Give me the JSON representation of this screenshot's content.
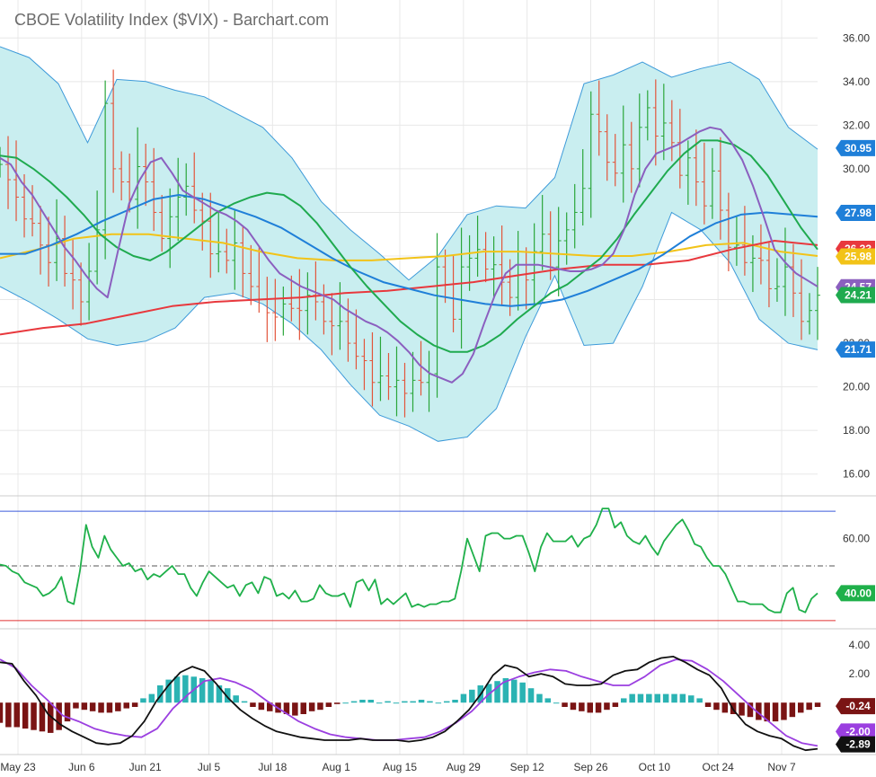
{
  "header": {
    "title": "CBOE Volatility Index ($VIX) - Barchart.com"
  },
  "colors": {
    "band_fill": "#c9eef0",
    "band_edge": "#3d9ad9",
    "up_bar": "#2aa63a",
    "down_bar": "#e2553b",
    "sma_purple": "#8b5fbf",
    "sma_green": "#1faa4f",
    "sma_blue": "#1f7fd8",
    "sma_yellow": "#f2c318",
    "sma_red": "#e8383d",
    "rsi_line": "#1fb04a",
    "macd_line": "#111111",
    "signal_line": "#9b3fe0",
    "hist_pos": "#2bb3b3",
    "hist_neg": "#7a1414",
    "grid": "#e8e8e8"
  },
  "chart_data": [
    {
      "type": "line",
      "panel": "price",
      "title": "CBOE Volatility Index ($VIX) - Barchart.com",
      "x": [
        "May 23",
        "Jun 6",
        "Jun 21",
        "Jul 5",
        "Jul 18",
        "Aug 1",
        "Aug 15",
        "Aug 29",
        "Sep 12",
        "Sep 26",
        "Oct 10",
        "Oct 24",
        "Nov 7"
      ],
      "ylim": [
        15,
        37
      ],
      "yticks": [
        "36.00",
        "34.00",
        "32.00",
        "30.00",
        "28.00",
        "26.00",
        "24.00",
        "22.00",
        "20.00",
        "18.00",
        "16.00"
      ],
      "close": [
        30.2,
        29.5,
        28.7,
        27.7,
        27.5,
        26.5,
        25.7,
        26.8,
        25.2,
        24.9,
        23.9,
        25.3,
        27.2,
        33.0,
        30.0,
        29.4,
        28.6,
        30.1,
        29.4,
        28.0,
        26.8,
        27.8,
        28.7,
        29.2,
        28.1,
        27.6,
        26.1,
        26.2,
        25.8,
        26.6,
        25.2,
        24.6,
        24.0,
        23.4,
        23.2,
        23.8,
        23.6,
        23.5,
        24.2,
        23.9,
        23.0,
        22.8,
        23.0,
        22.0,
        21.4,
        21.2,
        20.2,
        20.5,
        20.0,
        20.3,
        19.7,
        20.3,
        20.2,
        20.6,
        25.5,
        24.7,
        23.1,
        25.5,
        25.9,
        26.3,
        25.4,
        25.6,
        24.8,
        24.1,
        25.6,
        24.9,
        26.2,
        27.0,
        25.5,
        26.7,
        27.2,
        28.0,
        29.1,
        32.5,
        31.7,
        30.3,
        29.8,
        31.1,
        30.0,
        31.9,
        32.8,
        31.5,
        32.1,
        31.2,
        29.7,
        30.5,
        29.4,
        28.3,
        29.9,
        28.1,
        26.4,
        26.5,
        25.7,
        25.9,
        25.8,
        24.5,
        24.6,
        25.5,
        24.3,
        23.0,
        23.5,
        24.2
      ],
      "series": [
        {
          "name": "SMA purple",
          "values": [
            30.5,
            30.2,
            29.4,
            28.8,
            28.0,
            27.2,
            26.4,
            25.8,
            25.1,
            24.5,
            24.1,
            26.3,
            28.4,
            29.5,
            30.3,
            30.5,
            29.8,
            29.0,
            28.7,
            28.4,
            28.1,
            27.9,
            27.6,
            27.2,
            26.5,
            25.8,
            25.2,
            24.9,
            24.6,
            24.4,
            24.2,
            24.0,
            23.6,
            23.3,
            23.0,
            22.8,
            22.5,
            22.1,
            21.6,
            21.0,
            20.6,
            20.4,
            20.2,
            20.6,
            21.5,
            22.9,
            24.2,
            25.2,
            25.6,
            25.6,
            25.6,
            25.5,
            25.4,
            25.3,
            25.3,
            25.4,
            25.6,
            26.1,
            27.2,
            28.8,
            30.0,
            30.7,
            30.9,
            31.1,
            31.4,
            31.7,
            31.9,
            31.8,
            31.2,
            30.4,
            29.2,
            27.8,
            26.3,
            25.7,
            25.2,
            24.9,
            24.6
          ]
        },
        {
          "name": "SMA green",
          "values": [
            30.6,
            30.5,
            30.0,
            29.4,
            28.7,
            27.9,
            27.0,
            26.4,
            26.0,
            25.8,
            26.2,
            26.8,
            27.4,
            28.0,
            28.4,
            28.7,
            28.9,
            28.8,
            28.3,
            27.5,
            26.5,
            25.5,
            24.6,
            23.8,
            23.0,
            22.4,
            21.9,
            21.6,
            21.6,
            21.9,
            22.4,
            23.1,
            23.7,
            24.3,
            24.7,
            25.3,
            25.9,
            26.8,
            27.9,
            28.9,
            29.9,
            30.7,
            31.3,
            31.3,
            31.1,
            30.6,
            29.7,
            28.5,
            27.3,
            26.3
          ]
        },
        {
          "name": "SMA blue",
          "values": [
            26.1,
            26.1,
            26.5,
            27.0,
            27.6,
            28.1,
            28.6,
            28.8,
            28.6,
            28.2,
            27.8,
            27.3,
            26.6,
            25.9,
            25.3,
            24.8,
            24.5,
            24.2,
            24.0,
            23.8,
            23.7,
            23.8,
            24.0,
            24.4,
            24.9,
            25.4,
            26.1,
            26.9,
            27.5,
            27.9,
            28.0,
            27.9,
            27.8
          ]
        },
        {
          "name": "SMA yellow",
          "values": [
            25.9,
            26.3,
            26.8,
            27.0,
            27.0,
            26.8,
            26.6,
            26.2,
            25.9,
            25.8,
            25.8,
            25.9,
            26.0,
            26.2,
            26.2,
            26.1,
            26.0,
            26.0,
            26.2,
            26.5,
            26.6,
            26.2,
            26.0
          ]
        },
        {
          "name": "SMA red",
          "values": [
            22.4,
            22.7,
            22.9,
            23.3,
            23.7,
            23.9,
            24.0,
            24.1,
            24.3,
            24.4,
            24.6,
            24.8,
            25.1,
            25.4,
            25.6,
            25.6,
            25.8,
            26.3,
            26.7,
            26.5
          ]
        },
        {
          "name": "Upper band",
          "values": [
            35.6,
            35.1,
            33.9,
            31.2,
            34.1,
            34.0,
            33.6,
            33.3,
            32.6,
            31.9,
            30.5,
            28.5,
            27.2,
            26.1,
            24.9,
            26.0,
            27.9,
            28.3,
            28.2,
            29.6,
            33.9,
            34.3,
            34.9,
            34.2,
            34.6,
            34.9,
            34.1,
            31.9,
            30.9
          ]
        },
        {
          "name": "Lower band",
          "values": [
            24.6,
            23.9,
            23.1,
            22.2,
            21.9,
            22.1,
            22.7,
            24.1,
            24.3,
            23.8,
            22.9,
            21.7,
            20.1,
            18.7,
            18.2,
            17.5,
            17.7,
            19.0,
            22.3,
            25.1,
            21.9,
            22.0,
            24.6,
            28.0,
            27.2,
            25.7,
            23.1,
            22.0,
            21.7
          ]
        }
      ],
      "badges": [
        {
          "text": "30.95",
          "value": 30.95,
          "color": "#1f7fd8"
        },
        {
          "text": "27.98",
          "value": 27.98,
          "color": "#1f7fd8"
        },
        {
          "text": "26.33",
          "value": 26.33,
          "color": "#e8383d"
        },
        {
          "text": "25.98",
          "value": 25.98,
          "color": "#f2c318",
          "text_color": "#222222"
        },
        {
          "text": "24.57",
          "value": 24.57,
          "color": "#8b5fbf"
        },
        {
          "text": "24.21",
          "value": 24.21,
          "color": "#1faa4f"
        },
        {
          "text": "21.71",
          "value": 21.71,
          "color": "#1f7fd8"
        }
      ]
    },
    {
      "type": "line",
      "panel": "rsi",
      "ylim": [
        27,
        73
      ],
      "yticks": [
        "60.00"
      ],
      "upper_line": 70,
      "lower_line": 30,
      "mid_line": 50,
      "values": [
        50.5,
        50,
        48,
        47,
        44,
        43,
        42,
        39,
        40,
        42,
        46,
        37,
        36,
        48,
        65,
        57,
        53,
        61,
        56,
        53,
        50,
        51,
        48,
        49,
        45,
        47,
        46,
        48,
        50,
        47,
        47,
        42,
        39,
        44,
        48,
        46,
        44,
        42,
        43,
        39,
        43,
        44,
        40,
        46,
        45,
        39,
        40,
        38,
        41,
        37,
        37,
        38,
        43,
        40,
        39,
        39,
        40,
        35,
        44,
        45,
        41,
        45,
        36,
        38,
        36,
        38,
        40,
        35,
        36,
        35,
        36,
        36,
        37,
        37,
        38,
        48,
        60,
        54,
        48,
        61,
        62,
        62,
        60,
        60,
        61,
        61,
        55,
        48,
        57,
        62,
        59,
        59,
        59,
        61,
        57,
        60,
        61,
        65,
        71,
        71,
        64,
        66,
        61,
        59,
        58,
        61,
        57,
        54,
        59,
        62,
        65,
        67,
        63,
        58,
        57,
        53,
        50,
        50,
        47,
        42,
        37,
        37,
        36,
        36,
        36,
        34,
        33,
        33,
        40,
        42,
        34,
        33,
        38,
        40
      ]
    },
    {
      "type": "bar",
      "panel": "macd",
      "ylim": [
        -3.6,
        5.0
      ],
      "yticks": [
        "4.00",
        "2.00",
        "-2.00"
      ],
      "histogram": [
        -1.4,
        -1.7,
        -1.7,
        -1.8,
        -1.9,
        -2.0,
        -2.1,
        -1.9,
        -1.3,
        -0.4,
        -0.5,
        -0.6,
        -0.7,
        -0.7,
        -0.6,
        -0.4,
        -0.3,
        0.3,
        0.6,
        1.2,
        1.6,
        1.8,
        1.9,
        1.8,
        1.7,
        1.6,
        1.2,
        1.0,
        0.5,
        0.1,
        -0.3,
        -0.5,
        -0.6,
        -0.7,
        -0.8,
        -0.9,
        -0.8,
        -0.6,
        -0.5,
        -0.3,
        -0.1,
        0.0,
        0.1,
        0.2,
        0.2,
        0.0,
        0.1,
        0.0,
        0.1,
        0.1,
        0.2,
        0.1,
        0.0,
        0.1,
        0.2,
        0.6,
        0.9,
        1.2,
        1.3,
        1.5,
        1.7,
        1.6,
        1.4,
        1.0,
        0.6,
        0.3,
        0.0,
        -0.3,
        -0.5,
        -0.6,
        -0.7,
        -0.7,
        -0.5,
        -0.3,
        0.3,
        0.6,
        0.6,
        0.6,
        0.6,
        0.6,
        0.6,
        0.6,
        0.5,
        0.3,
        -0.3,
        -0.5,
        -0.7,
        -0.8,
        -0.9,
        -1.0,
        -1.2,
        -1.3,
        -1.3,
        -1.2,
        -1.0,
        -0.7,
        -0.5,
        -0.3
      ],
      "series": [
        {
          "name": "MACD",
          "values": [
            2.8,
            2.7,
            1.5,
            0.5,
            -0.8,
            -1.5,
            -2.0,
            -2.4,
            -2.8,
            -2.9,
            -2.8,
            -2.3,
            -1.3,
            0.1,
            1.2,
            2.1,
            2.5,
            2.2,
            1.3,
            0.3,
            -0.5,
            -1.1,
            -1.6,
            -2.0,
            -2.2,
            -2.4,
            -2.5,
            -2.6,
            -2.6,
            -2.6,
            -2.5,
            -2.6,
            -2.6,
            -2.6,
            -2.7,
            -2.6,
            -2.4,
            -2.0,
            -1.3,
            -0.5,
            0.6,
            1.9,
            2.6,
            2.4,
            1.8,
            2.0,
            1.8,
            1.3,
            1.2,
            1.2,
            1.3,
            1.9,
            2.2,
            2.3,
            2.8,
            3.1,
            3.2,
            2.8,
            2.3,
            1.9,
            1.0,
            -0.5,
            -1.5,
            -2.0,
            -2.3,
            -2.5,
            -3.0,
            -3.3,
            -3.2
          ]
        },
        {
          "name": "Signal",
          "values": [
            3.0,
            2.4,
            1.2,
            0.2,
            -0.9,
            -1.3,
            -1.8,
            -2.1,
            -2.3,
            -2.4,
            -1.8,
            -0.4,
            0.6,
            1.5,
            1.7,
            1.4,
            0.9,
            0.1,
            -0.6,
            -1.3,
            -1.8,
            -2.2,
            -2.4,
            -2.5,
            -2.6,
            -2.6,
            -2.5,
            -2.4,
            -2.0,
            -1.4,
            -0.6,
            0.5,
            1.4,
            1.8,
            2.1,
            2.3,
            2.2,
            1.8,
            1.5,
            1.2,
            1.2,
            1.8,
            2.6,
            3.0,
            2.9,
            2.3,
            1.5,
            0.5,
            -0.5,
            -1.4,
            -2.3,
            -2.8,
            -3.0
          ]
        }
      ],
      "badges": [
        {
          "text": "-0.24",
          "value": -0.24,
          "color": "#7a1414"
        },
        {
          "text": "-2.00",
          "value": -2.0,
          "color": "#9b3fe0"
        },
        {
          "text": "-2.89",
          "value": -2.89,
          "color": "#111111"
        }
      ]
    }
  ]
}
